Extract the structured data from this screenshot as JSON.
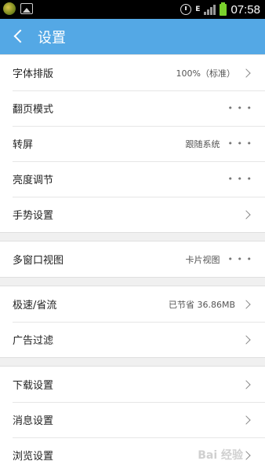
{
  "status_bar": {
    "network": "E",
    "time": "07:58"
  },
  "header": {
    "title": "设置"
  },
  "groups": [
    {
      "rows": [
        {
          "label": "字体排版",
          "value": "100%（标准）",
          "action": "chevron"
        },
        {
          "label": "翻页模式",
          "value": "",
          "action": "dots"
        },
        {
          "label": "转屏",
          "value": "跟随系统",
          "action": "dots"
        },
        {
          "label": "亮度调节",
          "value": "",
          "action": "dots"
        },
        {
          "label": "手势设置",
          "value": "",
          "action": "chevron"
        }
      ]
    },
    {
      "rows": [
        {
          "label": "多窗口视图",
          "value": "卡片视图",
          "action": "dots"
        }
      ]
    },
    {
      "rows": [
        {
          "label": "极速/省流",
          "value": "已节省 36.86MB",
          "action": "chevron"
        },
        {
          "label": "广告过滤",
          "value": "",
          "action": "chevron"
        }
      ]
    },
    {
      "rows": [
        {
          "label": "下载设置",
          "value": "",
          "action": "chevron"
        },
        {
          "label": "消息设置",
          "value": "",
          "action": "chevron"
        },
        {
          "label": "浏览设置",
          "value": "",
          "action": "chevron"
        }
      ]
    }
  ],
  "icons": {
    "back": "back-arrow-icon",
    "chevron": "chevron-right-icon",
    "dots": "more-dots-icon"
  },
  "colors": {
    "header": "#54a8e5",
    "background": "#f0f0f0"
  },
  "watermark": "Bai 经验"
}
